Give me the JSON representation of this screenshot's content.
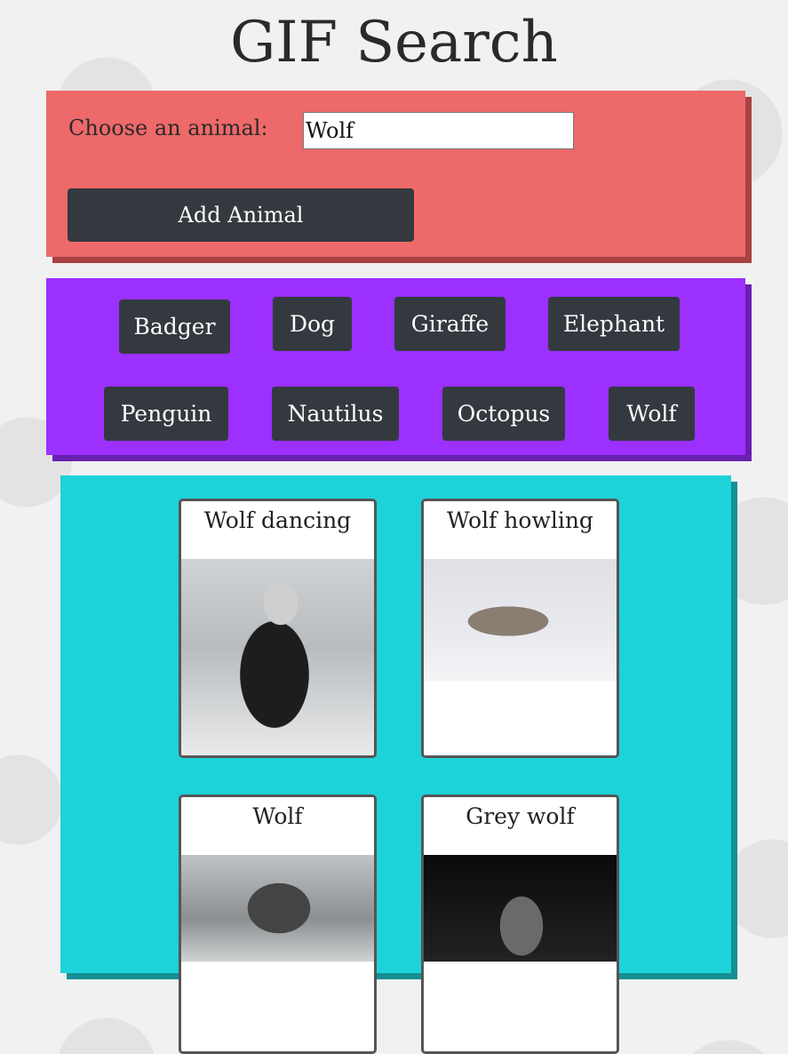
{
  "page": {
    "title": "GIF Search"
  },
  "form": {
    "label": "Choose an animal:",
    "input_value": "Wolf",
    "add_button_label": "Add Animal"
  },
  "animals": [
    "Badger",
    "Dog",
    "Giraffe",
    "Elephant",
    "Penguin",
    "Nautilus",
    "Octopus",
    "Wolf"
  ],
  "gifs": [
    {
      "title": "Wolf dancing"
    },
    {
      "title": "Wolf howling"
    },
    {
      "title": "Wolf"
    },
    {
      "title": "Grey wolf"
    }
  ],
  "colors": {
    "form_panel": "#ee6969",
    "buttons_panel": "#9b30ff",
    "results_panel": "#1dd3d9",
    "button": "#343940"
  }
}
